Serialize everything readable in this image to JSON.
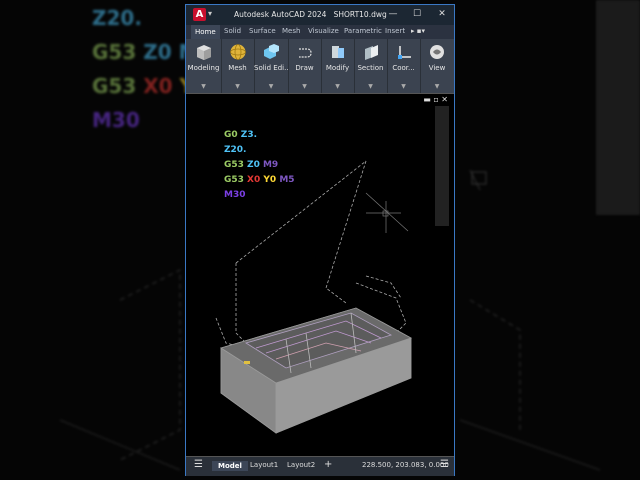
{
  "app": {
    "title": "Autodesk AutoCAD 2024",
    "file": "SHORT10.dwg",
    "logo_letter": "A",
    "accent": "#c8102e"
  },
  "window_controls": {
    "minimize": "—",
    "maximize": "☐",
    "close": "✕"
  },
  "tabs": [
    "Home",
    "Solid",
    "Surface",
    "Mesh",
    "Visualize",
    "Parametric",
    "Insert"
  ],
  "ribbon_panels": [
    {
      "label": "Modeling",
      "icon": "box-icon"
    },
    {
      "label": "Mesh",
      "icon": "sphere-icon"
    },
    {
      "label": "Solid Edi...",
      "icon": "solid-edit-icon"
    },
    {
      "label": "Draw",
      "icon": "polyline-icon"
    },
    {
      "label": "Modify",
      "icon": "move-icon"
    },
    {
      "label": "Section",
      "icon": "section-plane-icon"
    },
    {
      "label": "Coor...",
      "icon": "ucs-icon"
    },
    {
      "label": "View",
      "icon": "view-icon"
    }
  ],
  "gcode": [
    [
      {
        "t": "G0 ",
        "c": "#9ccc65"
      },
      {
        "t": "Z3.",
        "c": "#4fc3f7"
      }
    ],
    [
      {
        "t": "Z20.",
        "c": "#4fc3f7"
      }
    ],
    [
      {
        "t": "G53 ",
        "c": "#9ccc65"
      },
      {
        "t": "Z0 ",
        "c": "#4fc3f7"
      },
      {
        "t": "M9",
        "c": "#7e57c2"
      }
    ],
    [
      {
        "t": "G53 ",
        "c": "#9ccc65"
      },
      {
        "t": "X0 ",
        "c": "#e53935"
      },
      {
        "t": "Y0 ",
        "c": "#fdd835"
      },
      {
        "t": "M5",
        "c": "#7e57c2"
      }
    ],
    [
      {
        "t": "M30",
        "c": "#7b3fe4"
      }
    ]
  ],
  "status": {
    "model": "Model",
    "layout1": "Layout1",
    "layout2": "Layout2",
    "add": "+",
    "coords": "228.500, 203.083, 0.000"
  },
  "background_text": [
    [
      {
        "t": "Z20.",
        "c": "#4fc3f7"
      }
    ],
    [
      {
        "t": "G53 ",
        "c": "#9ccc65"
      },
      {
        "t": "Z0 M",
        "c": "#4fc3f7"
      }
    ],
    [
      {
        "t": "G53 ",
        "c": "#9ccc65"
      },
      {
        "t": "X0 ",
        "c": "#e53935"
      },
      {
        "t": "Y",
        "c": "#fdd835"
      }
    ],
    [
      {
        "t": "M30",
        "c": "#7b3fe4"
      }
    ]
  ]
}
